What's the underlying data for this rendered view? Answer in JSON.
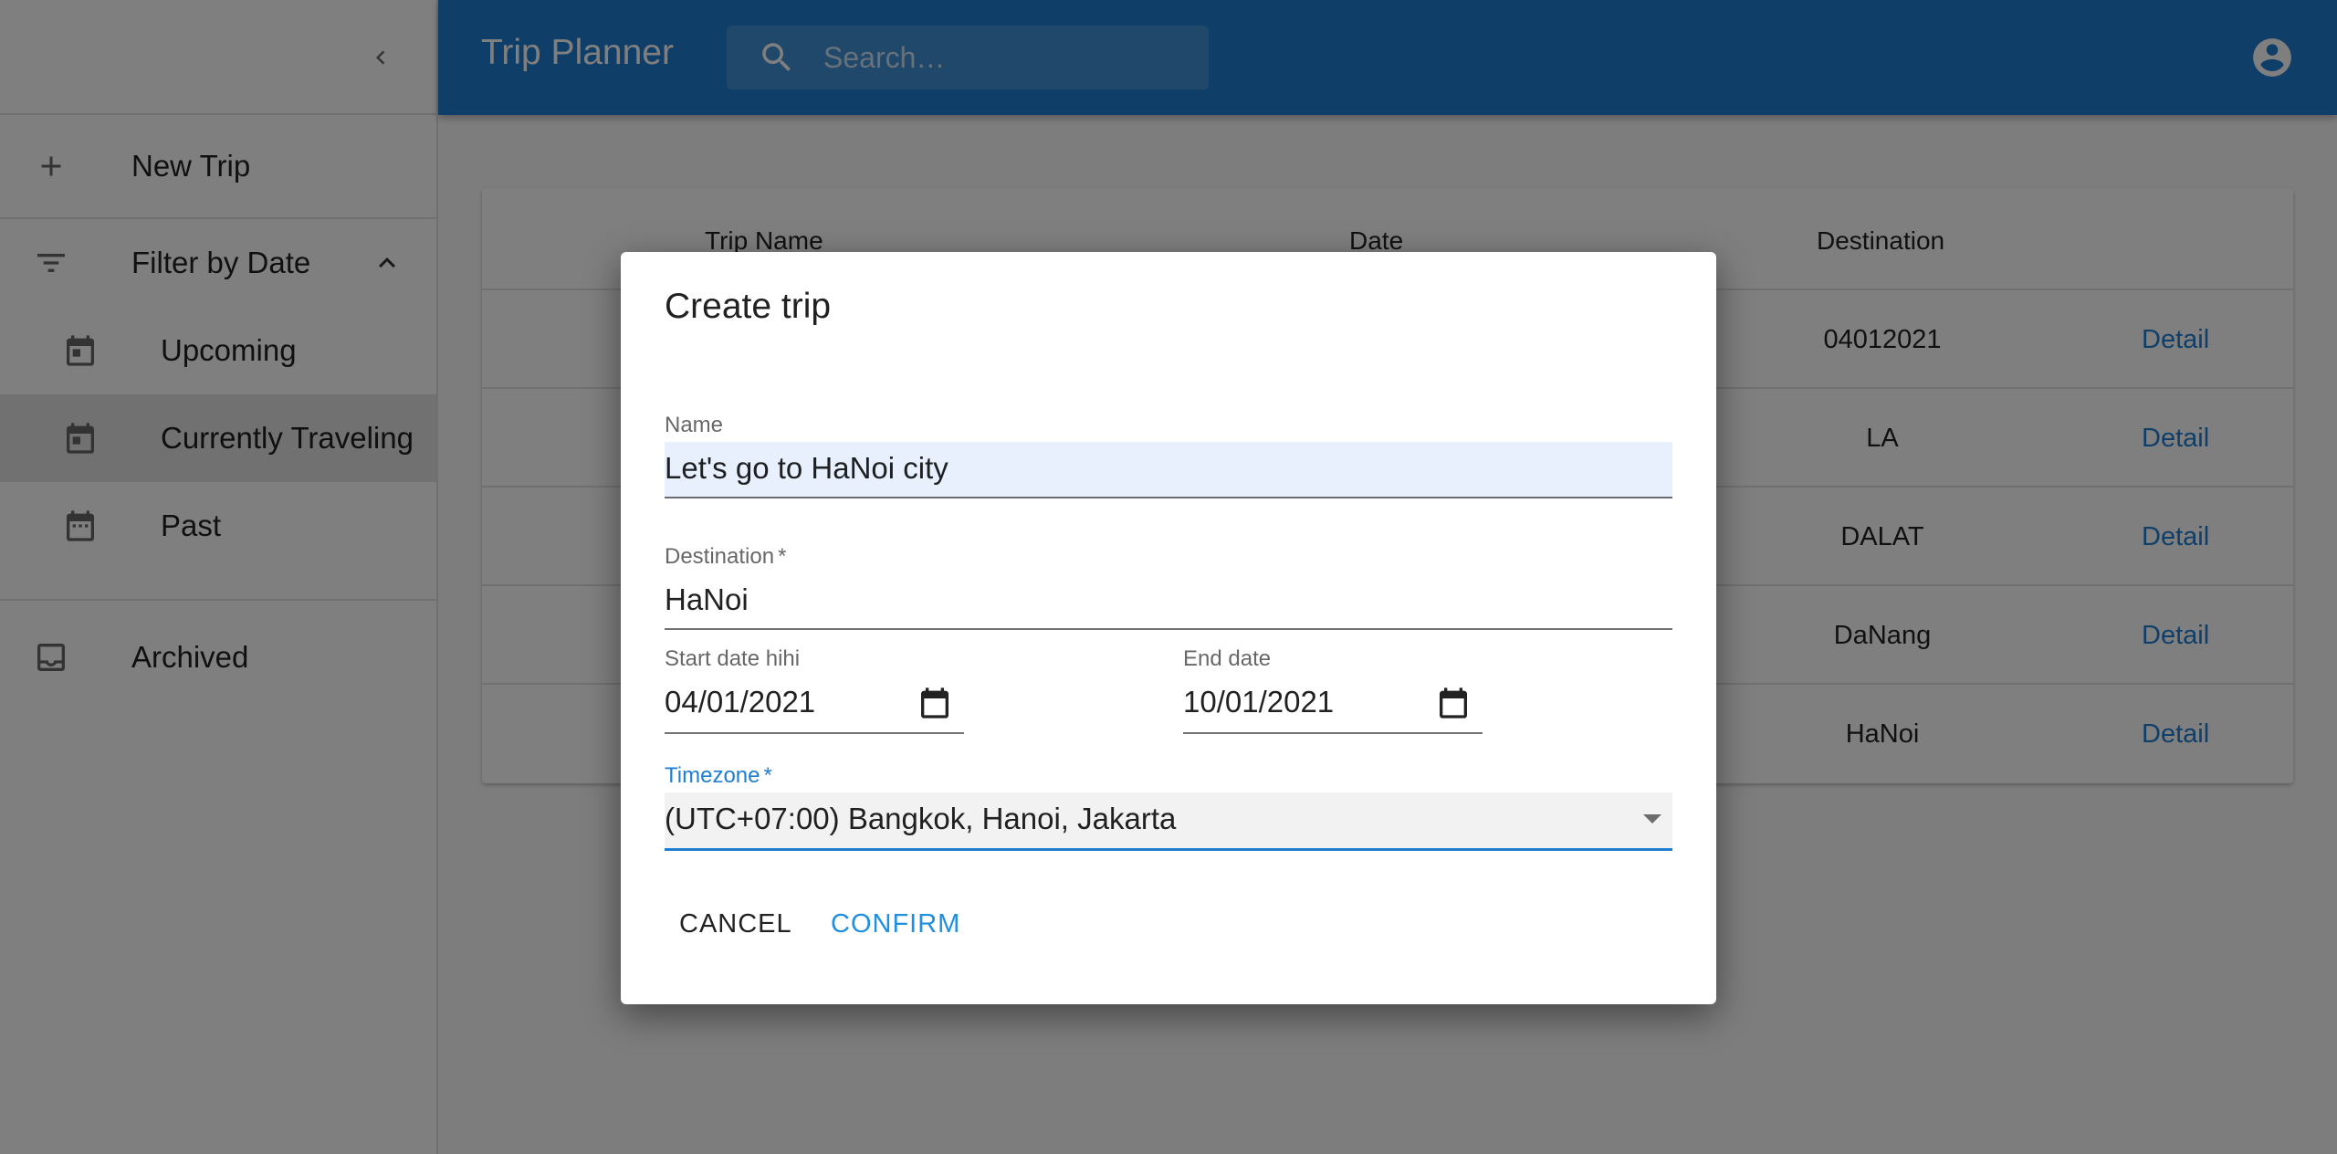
{
  "sidebar": {
    "items": [
      {
        "label": "New Trip",
        "icon": "plus-icon"
      },
      {
        "label": "Filter by Date",
        "icon": "filter-icon"
      },
      {
        "label": "Upcoming",
        "icon": "calendar-icon"
      },
      {
        "label": "Currently Traveling",
        "icon": "calendar-icon",
        "selected": true
      },
      {
        "label": "Past",
        "icon": "calendar-icon"
      },
      {
        "label": "Archived",
        "icon": "archive-icon"
      }
    ]
  },
  "appbar": {
    "title": "Trip Planner",
    "search_placeholder": "Search…"
  },
  "table": {
    "headers": [
      "Trip Name",
      "Date",
      "Destination"
    ],
    "rows": [
      {
        "destination": "04012021",
        "action": "Detail"
      },
      {
        "destination": "LA",
        "action": "Detail"
      },
      {
        "destination": "DALAT",
        "action": "Detail"
      },
      {
        "destination": "DaNang",
        "action": "Detail"
      },
      {
        "destination": "HaNoi",
        "action": "Detail"
      }
    ]
  },
  "dialog": {
    "title": "Create trip",
    "name_label": "Name",
    "name_value": "Let's go to HaNoi city",
    "destination_label": "Destination",
    "destination_value": "HaNoi",
    "start_label": "Start date hihi",
    "start_value": "04/01/2021",
    "end_label": "End date",
    "end_value": "10/01/2021",
    "timezone_label": "Timezone",
    "timezone_value": "(UTC+07:00) Bangkok, Hanoi, Jakarta",
    "required_mark": "*",
    "cancel_label": "CANCEL",
    "confirm_label": "CONFIRM"
  },
  "colors": {
    "primary": "#1f7ed1",
    "confirm": "#1f8fe0"
  }
}
